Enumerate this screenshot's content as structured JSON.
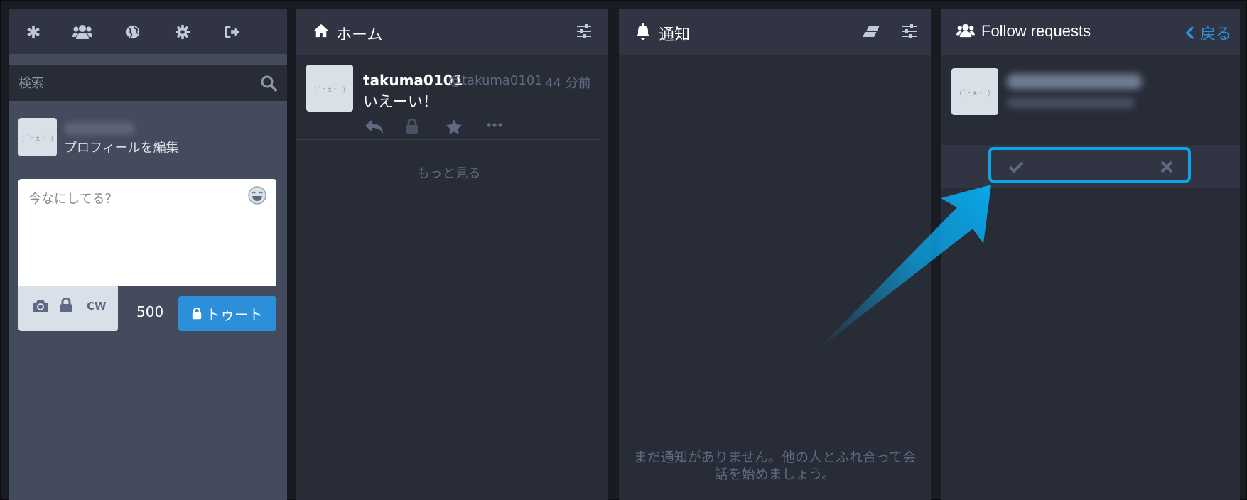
{
  "nav": {
    "items": [
      {
        "icon": "asterisk-icon"
      },
      {
        "icon": "users-icon"
      },
      {
        "icon": "globe-icon"
      },
      {
        "icon": "gear-icon"
      },
      {
        "icon": "sign-out-icon"
      }
    ]
  },
  "search": {
    "placeholder": "検索"
  },
  "profile": {
    "edit_label": "プロフィールを編集",
    "avatar_face": "(´・ᴥ・`)"
  },
  "compose": {
    "placeholder": "今なにしてる？",
    "char_count": "500",
    "toot_label": "トゥート",
    "cw_label": "CW"
  },
  "home": {
    "title": "ホーム",
    "status": {
      "display_name": "takuma0101",
      "acct": "@takuma0101",
      "time": "44 分前",
      "content": "いえーい！"
    },
    "load_more": "もっと見る"
  },
  "notifications": {
    "title": "通知",
    "empty_message": "まだ通知がありません。他の人とふれ合って会話を始めましょう。"
  },
  "follow_requests": {
    "title": "Follow requests",
    "back_label": "戻る"
  },
  "colors": {
    "accent": "#2b90d9",
    "highlight": "#0aa5e8",
    "column_bg": "#282c37",
    "header_bg": "#313543"
  }
}
